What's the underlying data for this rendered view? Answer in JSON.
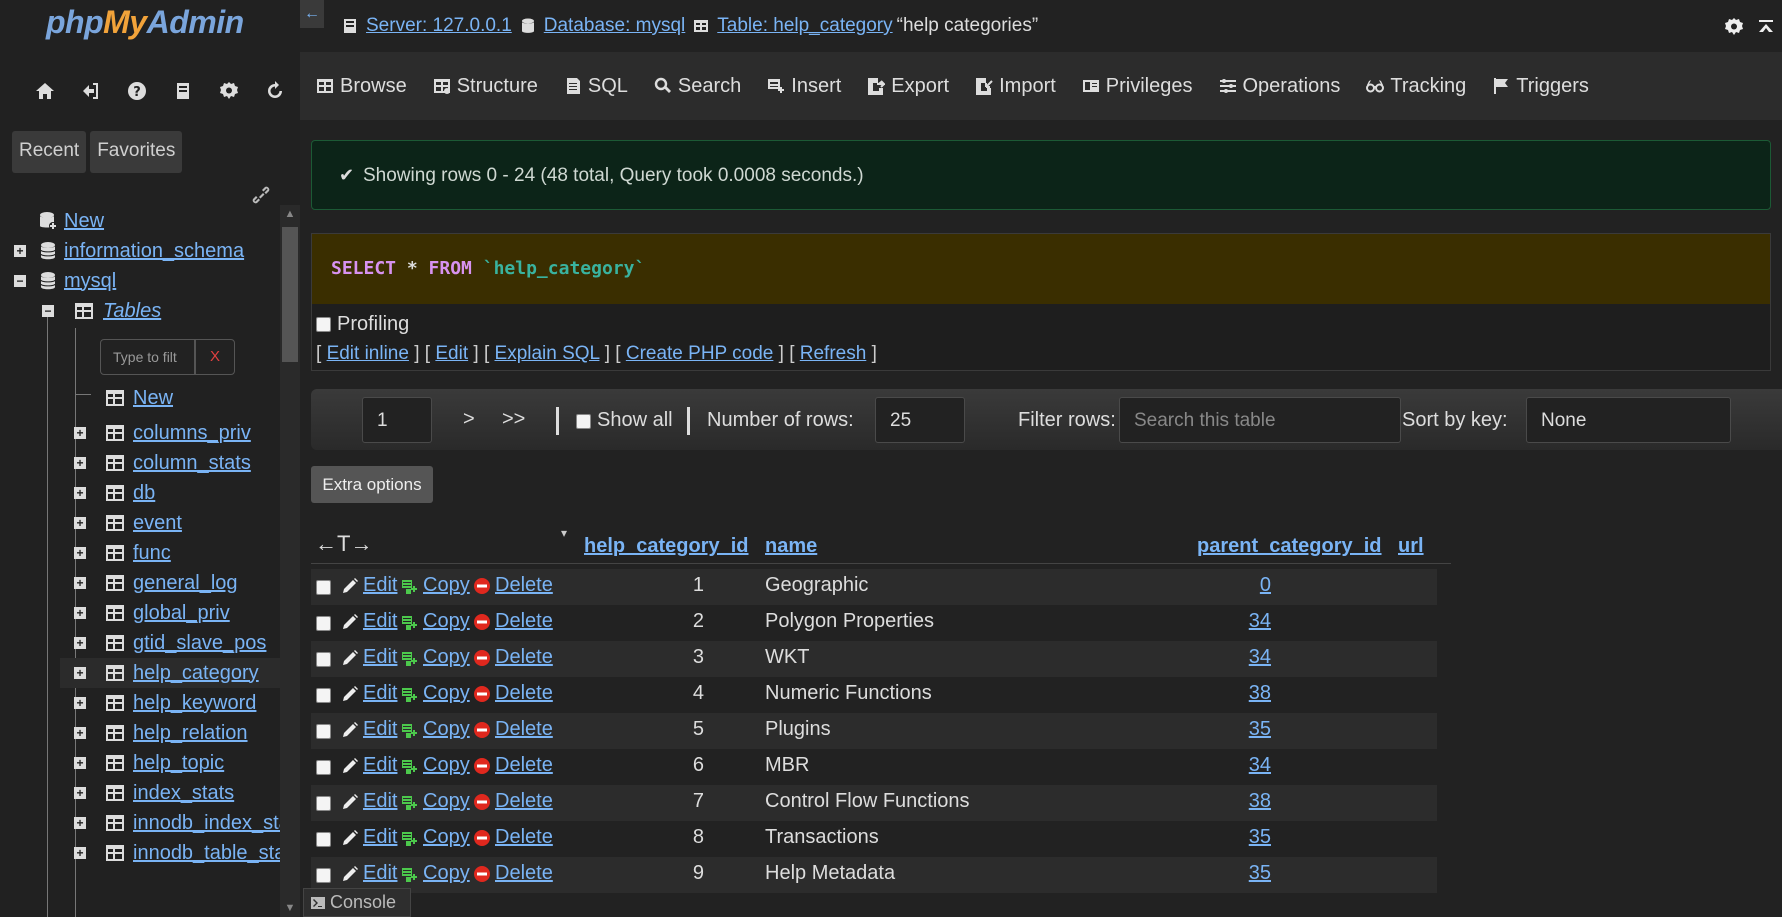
{
  "logo": {
    "part1": "php",
    "part2": "My",
    "part3": "Admin"
  },
  "nav_icons": [
    "home-icon",
    "logout-icon",
    "help-icon",
    "docs-icon",
    "settings-icon",
    "reload-icon"
  ],
  "nav_tabs": {
    "recent": "Recent",
    "favorites": "Favorites"
  },
  "tree": {
    "new": "New",
    "information_schema": "information_schema",
    "mysql": "mysql",
    "tables": "Tables",
    "filter_placeholder": "Type to filt",
    "filter_clear": "X",
    "new_table": "New",
    "tables_list": [
      "columns_priv",
      "column_stats",
      "db",
      "event",
      "func",
      "general_log",
      "global_priv",
      "gtid_slave_pos",
      "help_category",
      "help_keyword",
      "help_relation",
      "help_topic",
      "index_stats",
      "innodb_index_sta",
      "innodb_table_sta"
    ]
  },
  "breadcrumb": {
    "server": "Server: 127.0.0.1",
    "database": "Database: mysql",
    "table": "Table: help_category",
    "description": "“help categories”"
  },
  "collapse_label": "←",
  "menu": [
    "Browse",
    "Structure",
    "SQL",
    "Search",
    "Insert",
    "Export",
    "Import",
    "Privileges",
    "Operations",
    "Tracking",
    "Triggers"
  ],
  "success": {
    "check": "✔",
    "message": "Showing rows 0 - 24 (48 total, Query took 0.0008 seconds.)"
  },
  "sql": {
    "select": "SELECT",
    "star": " * ",
    "from": "FROM",
    "table": " `help_category`"
  },
  "profiling": "Profiling",
  "sql_links": {
    "open": "[ ",
    "edit_inline": "Edit inline",
    "sep": " ] [ ",
    "edit": "Edit",
    "explain": "Explain SQL",
    "create_php": "Create PHP code",
    "refresh": "Refresh",
    "close": " ]"
  },
  "navigation": {
    "page": "1",
    "next": ">",
    "last": ">>",
    "show_all": "Show all",
    "num_rows_label": "Number of rows:",
    "num_rows": "25",
    "filter_label": "Filter rows:",
    "filter_placeholder": "Search this table",
    "sort_label": "Sort by key:",
    "sort_value": "None"
  },
  "extra_options": "Extra options",
  "table": {
    "arrows": "←T→",
    "sort_marker": "▾",
    "columns": [
      "help_category_id",
      "name",
      "parent_category_id",
      "url"
    ],
    "actions": {
      "edit": "Edit",
      "copy": "Copy",
      "delete": "Delete"
    },
    "rows": [
      {
        "id": "1",
        "name": "Geographic",
        "parent": "0"
      },
      {
        "id": "2",
        "name": "Polygon Properties",
        "parent": "34"
      },
      {
        "id": "3",
        "name": "WKT",
        "parent": "34"
      },
      {
        "id": "4",
        "name": "Numeric Functions",
        "parent": "38"
      },
      {
        "id": "5",
        "name": "Plugins",
        "parent": "35"
      },
      {
        "id": "6",
        "name": "MBR",
        "parent": "34"
      },
      {
        "id": "7",
        "name": "Control Flow Functions",
        "parent": "38"
      },
      {
        "id": "8",
        "name": "Transactions",
        "parent": "35"
      },
      {
        "id": "9",
        "name": "Help Metadata",
        "parent": "35"
      }
    ]
  },
  "console": "Console",
  "colors": {
    "link": "#7ab4f5",
    "success_bg": "#0c2418",
    "sql_bg": "#3a2e00",
    "keyword": "#d792f0",
    "table_name": "#39b39f",
    "copy_icon": "#4cc94c",
    "delete_icon": "#e0281e",
    "logo_orange": "#f2a33a",
    "logo_blue": "#7aa5dc"
  }
}
